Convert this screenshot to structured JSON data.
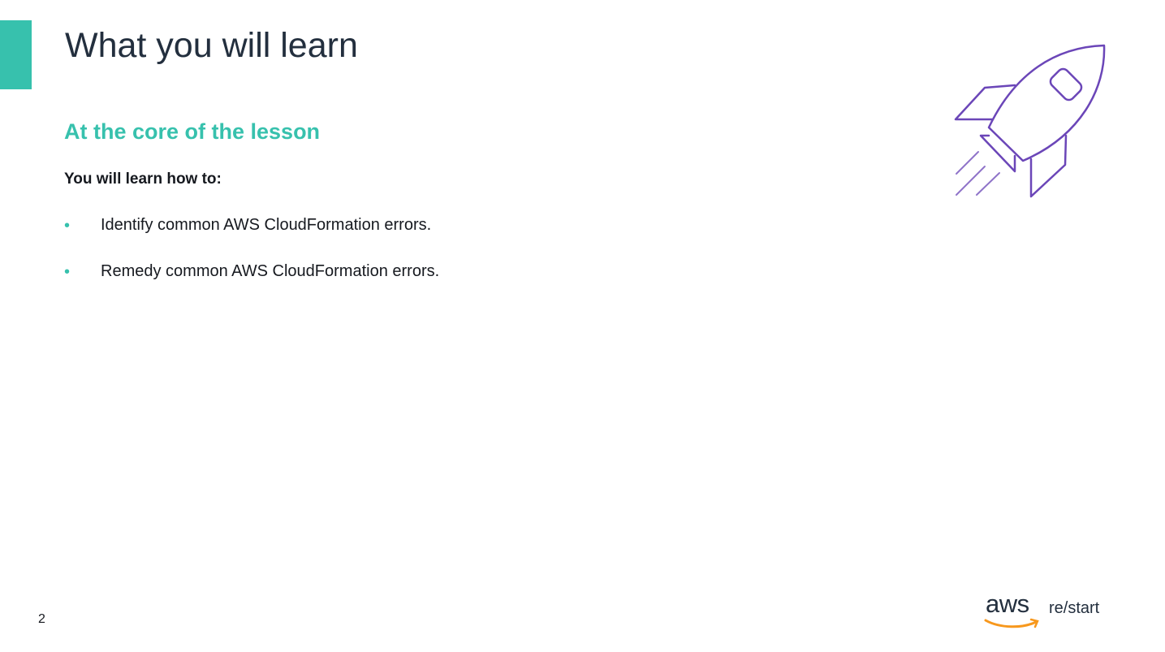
{
  "slide": {
    "title": "What you will learn",
    "subtitle": "At the core of the lesson",
    "intro": "You will learn how to:",
    "bullets": [
      "Identify common AWS CloudFormation errors.",
      "Remedy common AWS CloudFormation errors."
    ],
    "page_number": "2",
    "icon": "rocket-icon"
  },
  "logo": {
    "brand": "aws",
    "product": "re/start"
  },
  "colors": {
    "accent": "#37c1ad",
    "icon": "#6b46b8",
    "text": "#232f3e",
    "smile": "#f7981d"
  }
}
